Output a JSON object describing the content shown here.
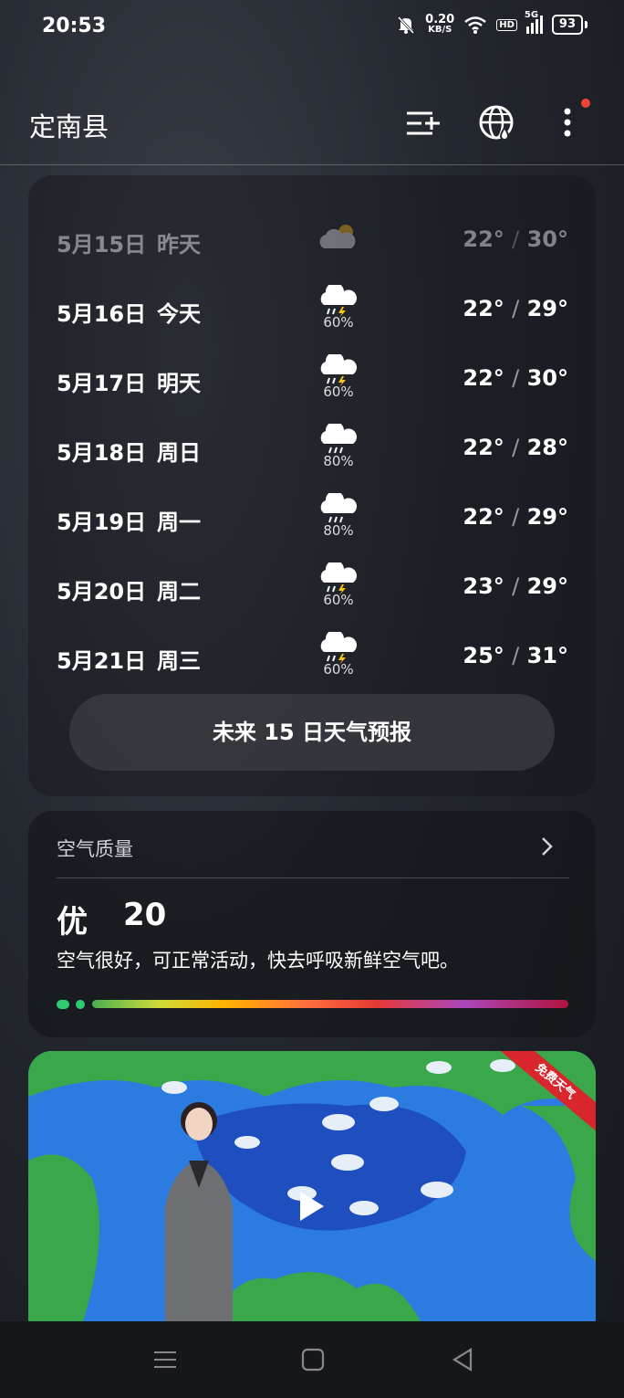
{
  "status_bar": {
    "time": "20:53",
    "net_speed_value": "0.20",
    "net_speed_unit": "KB/S",
    "hd": "HD",
    "signal": "5G",
    "battery": "93",
    "icons": [
      "mute-bell-icon",
      "wifi-icon",
      "signal-icon",
      "battery-icon"
    ]
  },
  "header": {
    "city": "定南县",
    "icons": [
      "manage-cities-icon",
      "globe-icon",
      "more-icon"
    ],
    "notification_dot_color": "#f44336"
  },
  "forecast": {
    "rows": [
      {
        "date": "5月15日",
        "day": "昨天",
        "icon": "cloudy-icon",
        "pct": "",
        "low": "22°",
        "high": "30°",
        "past": true
      },
      {
        "date": "5月16日",
        "day": "今天",
        "icon": "thunder-rain-icon",
        "pct": "60%",
        "low": "22°",
        "high": "29°"
      },
      {
        "date": "5月17日",
        "day": "明天",
        "icon": "thunder-rain-icon",
        "pct": "60%",
        "low": "22°",
        "high": "30°"
      },
      {
        "date": "5月18日",
        "day": "周日",
        "icon": "rain-icon",
        "pct": "80%",
        "low": "22°",
        "high": "28°"
      },
      {
        "date": "5月19日",
        "day": "周一",
        "icon": "rain-icon",
        "pct": "80%",
        "low": "22°",
        "high": "29°"
      },
      {
        "date": "5月20日",
        "day": "周二",
        "icon": "thunder-rain-icon",
        "pct": "60%",
        "low": "23°",
        "high": "29°"
      },
      {
        "date": "5月21日",
        "day": "周三",
        "icon": "thunder-rain-icon",
        "pct": "60%",
        "low": "25°",
        "high": "31°"
      }
    ],
    "button_label": "未来 15 日天气预报",
    "temp_separator": "/"
  },
  "air_quality": {
    "title": "空气质量",
    "level": "优",
    "value": "20",
    "description": "空气很好，可正常活动，快去呼吸新鲜空气吧。",
    "accent_color": "#2ecc71"
  },
  "video": {
    "ribbon_text": "免费天气",
    "ribbon_color": "#d8262c",
    "icons": [
      "play-icon"
    ]
  },
  "navbar": {
    "icons": [
      "recent-apps-icon",
      "home-icon",
      "back-icon"
    ]
  }
}
